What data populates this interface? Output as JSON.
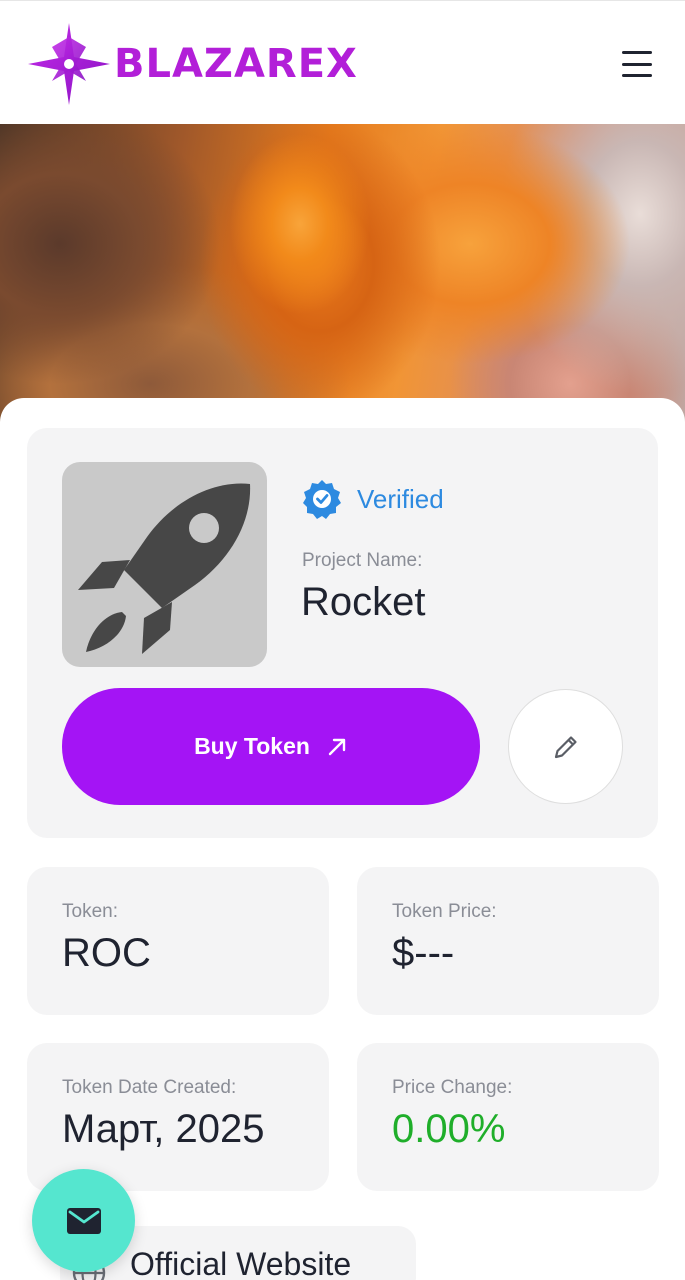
{
  "header": {
    "brand": "BLAZAREX",
    "logo_icon": "star-logo-icon",
    "menu_icon": "hamburger-menu-icon",
    "brand_color": "#b21fd8"
  },
  "project": {
    "verified_label": "Verified",
    "verified_icon": "verified-badge-icon",
    "name_label": "Project Name:",
    "name": "Rocket",
    "avatar_icon": "rocket-icon",
    "buy_label": "Buy Token",
    "buy_icon": "arrow-up-right-icon",
    "edit_icon": "pencil-icon",
    "accent_color": "#a414f5",
    "verified_color": "#2d8ae0"
  },
  "stats": {
    "token_label": "Token:",
    "token_value": "ROC",
    "price_label": "Token Price:",
    "price_value": "$---",
    "date_label": "Token Date Created:",
    "date_value": "Март, 2025",
    "change_label": "Price Change:",
    "change_value": "0.00%",
    "change_color": "#1fae2a"
  },
  "links": {
    "website_label": "Official Website",
    "website_icon": "globe-icon"
  },
  "fab": {
    "icon": "mail-icon",
    "color": "#55e6cf"
  }
}
